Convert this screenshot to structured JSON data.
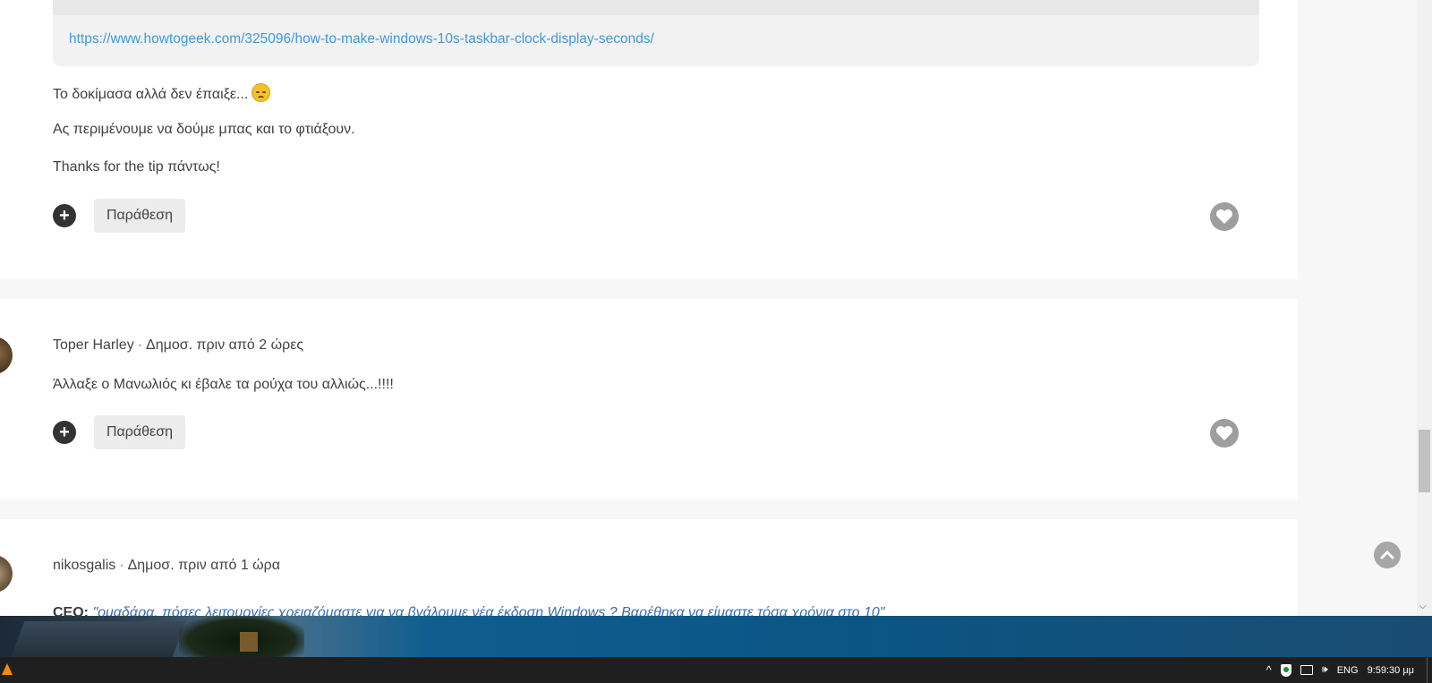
{
  "post1": {
    "quote_link": "https://www.howtogeek.com/325096/how-to-make-windows-10s-taskbar-clock-display-seconds/",
    "line1": "Το δοκίμασα αλλά δεν έπαιξε...",
    "emoji": "disappointed-face-emoji",
    "line2": "Ας περιμένουμε να δούμε μπας και το φτιάξουν.",
    "line3": "Thanks for the tip πάντως!",
    "plus_label": "+",
    "quote_button": "Παράθεση"
  },
  "post2": {
    "author": "Toper Harley",
    "separator": "·",
    "date": "Δημοσ. πριν από 2 ώρες",
    "text": "Άλλαξε ο Μανωλιός κι έβαλε τα ρούχα του αλλιώς...!!!!",
    "plus_label": "+",
    "quote_button": "Παράθεση"
  },
  "post3": {
    "author": "nikosgalis",
    "separator": "·",
    "date": "Δημοσ. πριν από 1 ώρα",
    "speaker": "CEO:",
    "text": "\"ομαδάρα, πόσες λειτουργίες χρειαζόμαστε για να βγάλουμε νέα έκδοση Windows ? Βαρέθηκα να είμαστε τόσα χρόνια στο 10\""
  },
  "taskbar": {
    "chevron": "^",
    "volume": "🕪",
    "volume_icon_label": "ENG",
    "language": "ENG",
    "clock": "9:59:30 μμ"
  },
  "colors": {
    "link": "#3d9bd8",
    "like_button": "#9e9e9e",
    "plus_button": "#333333",
    "taskbar": "#1f1f1f"
  }
}
